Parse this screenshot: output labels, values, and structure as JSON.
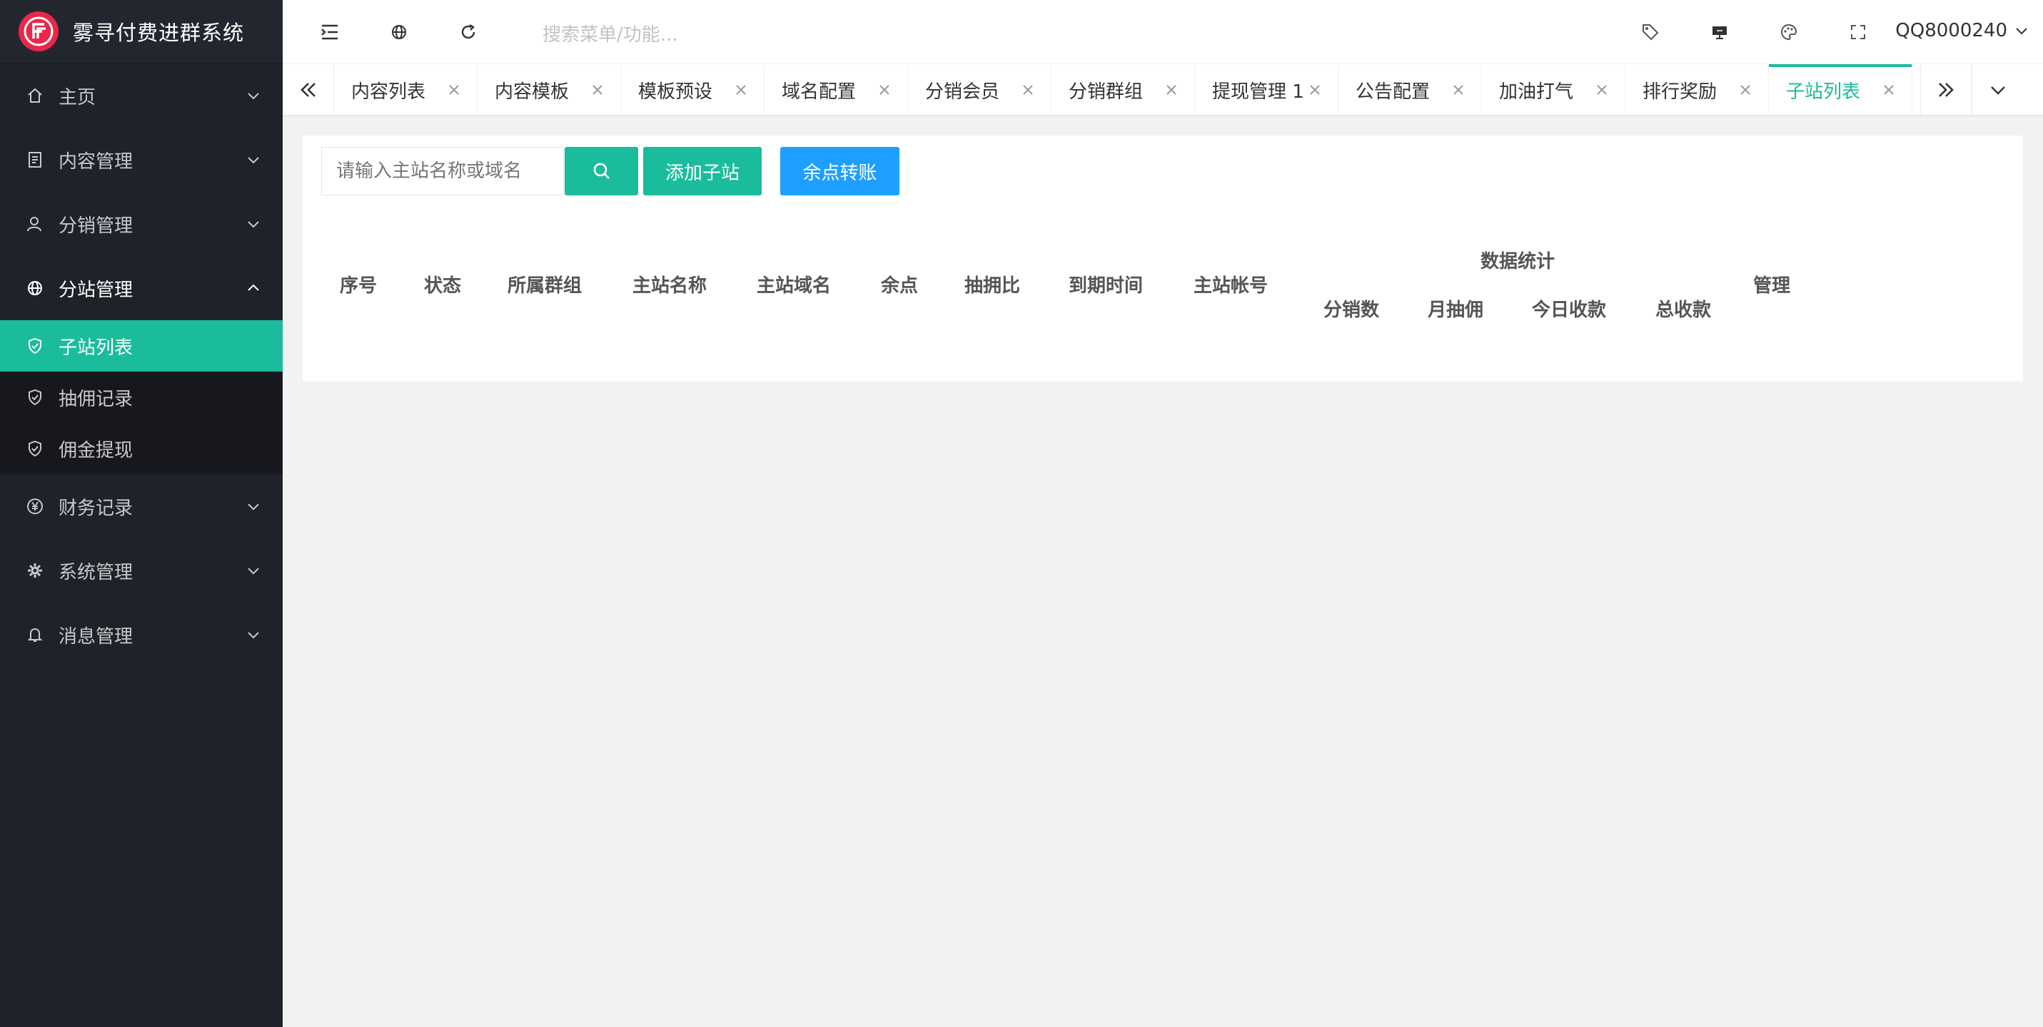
{
  "app": {
    "title": "雾寻付费进群系统",
    "brand_color": "#e8284b",
    "accent_color": "#1bbc9b",
    "blue_color": "#1e9fff"
  },
  "sidebar": {
    "items": [
      {
        "label": "主页",
        "icon": "home-icon"
      },
      {
        "label": "内容管理",
        "icon": "document-icon"
      },
      {
        "label": "分销管理",
        "icon": "user-icon"
      },
      {
        "label": "分站管理",
        "icon": "globe-icon",
        "expanded": true,
        "children": [
          {
            "label": "子站列表",
            "icon": "shield-check-icon",
            "active": true
          },
          {
            "label": "抽佣记录",
            "icon": "shield-check-icon"
          },
          {
            "label": "佣金提现",
            "icon": "shield-check-icon"
          }
        ]
      },
      {
        "label": "财务记录",
        "icon": "yen-icon"
      },
      {
        "label": "系统管理",
        "icon": "gear-icon"
      },
      {
        "label": "消息管理",
        "icon": "bell-icon"
      }
    ]
  },
  "header": {
    "search_placeholder": "搜索菜单/功能...",
    "user": "QQ8000240",
    "icons": [
      "menu-fold-icon",
      "globe-icon",
      "refresh-icon",
      "tag-icon",
      "monitor-icon",
      "palette-icon",
      "fullscreen-icon"
    ]
  },
  "tabs": {
    "items": [
      {
        "label": "内容列表"
      },
      {
        "label": "内容模板"
      },
      {
        "label": "模板预设"
      },
      {
        "label": "域名配置"
      },
      {
        "label": "分销会员"
      },
      {
        "label": "分销群组"
      },
      {
        "label": "提现管理 1"
      },
      {
        "label": "公告配置"
      },
      {
        "label": "加油打气"
      },
      {
        "label": "排行奖励"
      },
      {
        "label": "子站列表",
        "active": true
      }
    ]
  },
  "toolbar": {
    "search_placeholder": "请输入主站名称或域名",
    "add_label": "添加子站",
    "transfer_label": "余点转账"
  },
  "table": {
    "columns": [
      "序号",
      "状态",
      "所属群组",
      "主站名称",
      "主站域名",
      "余点",
      "抽拥比",
      "到期时间",
      "主站帐号"
    ],
    "group_header": "数据统计",
    "group_columns": [
      "分销数",
      "月抽佣",
      "今日收款",
      "总收款"
    ],
    "manage_header": "管理",
    "rows": []
  }
}
